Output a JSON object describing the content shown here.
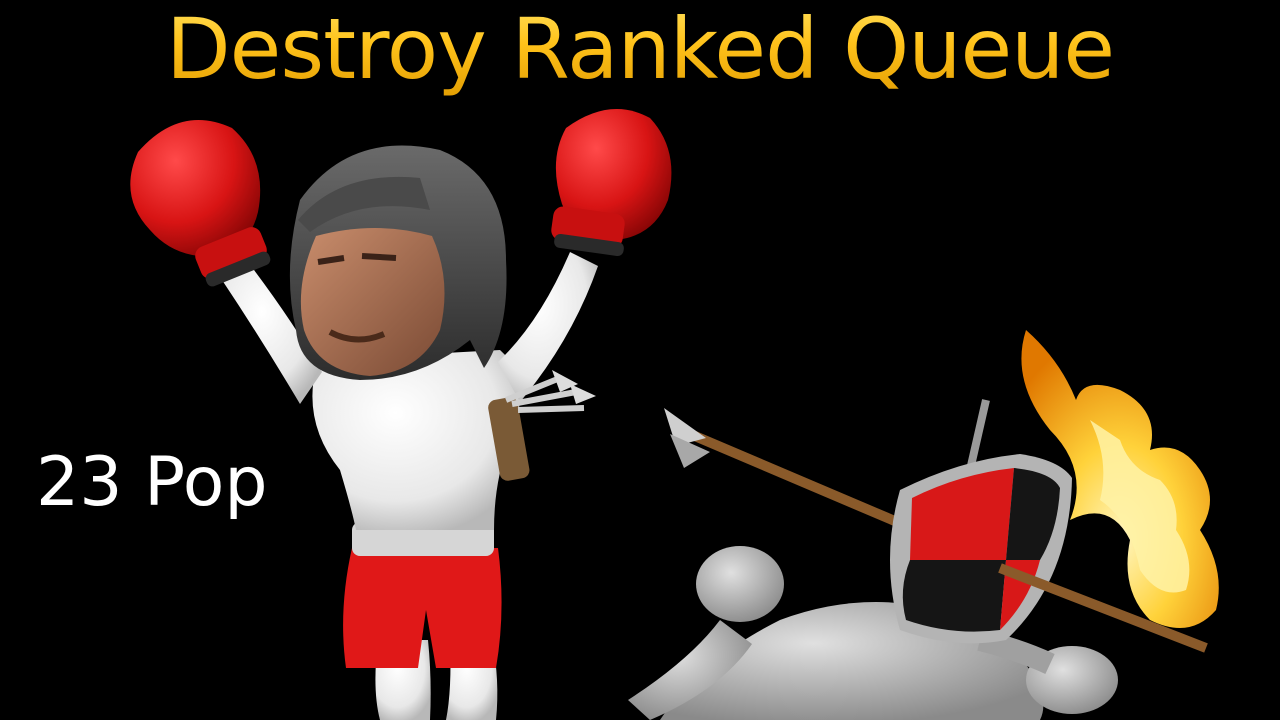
{
  "thumbnail": {
    "title": "Destroy Ranked Queue",
    "pop_label": "23 Pop"
  },
  "colors": {
    "background": "#000000",
    "title_gold": "#ffc21a",
    "glove_red": "#d81414",
    "shorts_red": "#e01818",
    "figure_white": "#f2f2f2",
    "fallen_grey": "#bdbdbd",
    "flame_yellow": "#ffd23a"
  },
  "icons": {
    "winner": "boxer-figure-icon",
    "loser": "fallen-figure-icon",
    "shield": "heraldic-shield-icon",
    "arrow": "arrow-icon",
    "fire": "fire-arrow-icon"
  }
}
